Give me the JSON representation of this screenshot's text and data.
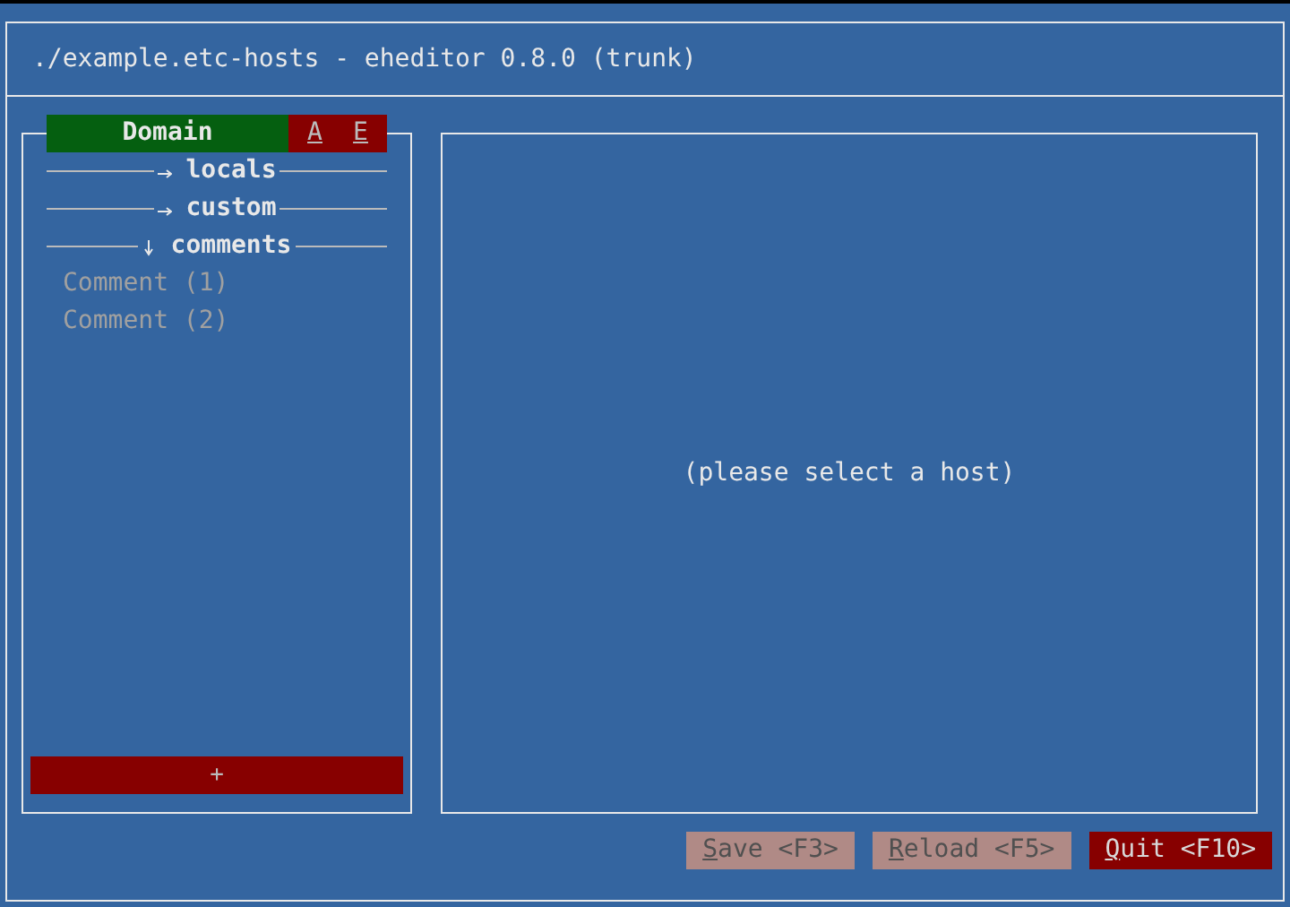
{
  "window": {
    "title": "./example.etc-hosts - eheditor 0.8.0 (trunk)"
  },
  "list_header": {
    "title": "Domain",
    "actions": [
      "A",
      "E"
    ]
  },
  "groups": [
    {
      "label": "locals",
      "expanded": false
    },
    {
      "label": "custom",
      "expanded": false
    },
    {
      "label": "comments",
      "expanded": true,
      "children": [
        "Comment (1)",
        "Comment (2)"
      ]
    }
  ],
  "add_button": "+",
  "detail": {
    "placeholder": "(please select a host)"
  },
  "buttons": [
    {
      "label": "Save <F3>",
      "disabled": true
    },
    {
      "label": "Reload <F5>",
      "disabled": true
    },
    {
      "label": "Quit <F10>",
      "disabled": false
    }
  ]
}
